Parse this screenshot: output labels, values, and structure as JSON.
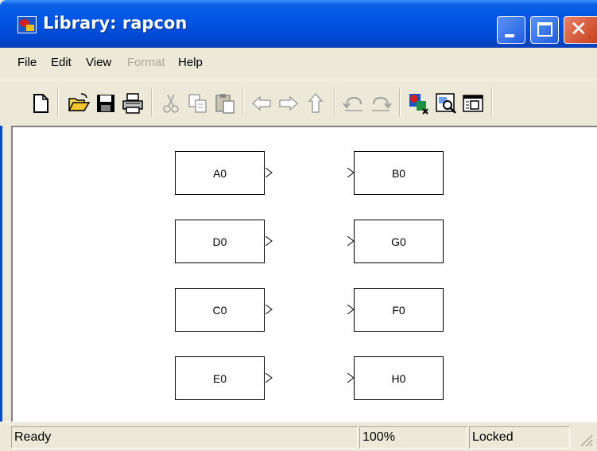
{
  "window": {
    "title": "Library: rapcon",
    "close_glyph": "✕"
  },
  "menu": [
    {
      "label": "File",
      "enabled": true
    },
    {
      "label": "Edit",
      "enabled": true
    },
    {
      "label": "View",
      "enabled": true
    },
    {
      "label": "Format",
      "enabled": false
    },
    {
      "label": "Help",
      "enabled": true
    }
  ],
  "toolbar": {
    "icons": [
      "new-icon",
      "open-icon",
      "save-icon",
      "print-icon",
      "cut-icon",
      "copy-icon",
      "paste-icon",
      "back-icon",
      "forward-icon",
      "up-icon",
      "undo-icon",
      "redo-icon",
      "library-browser-icon",
      "model-explorer-icon",
      "debugger-icon"
    ]
  },
  "blocks": {
    "left": [
      "A0",
      "D0",
      "C0",
      "E0"
    ],
    "right": [
      "B0",
      "G0",
      "F0",
      "H0"
    ]
  },
  "status": {
    "state": "Ready",
    "zoom": "100%",
    "lock": "Locked"
  },
  "colors": {
    "titlebar": "#0054e3",
    "chrome": "#ece9d8",
    "close_button": "#c8401a"
  }
}
